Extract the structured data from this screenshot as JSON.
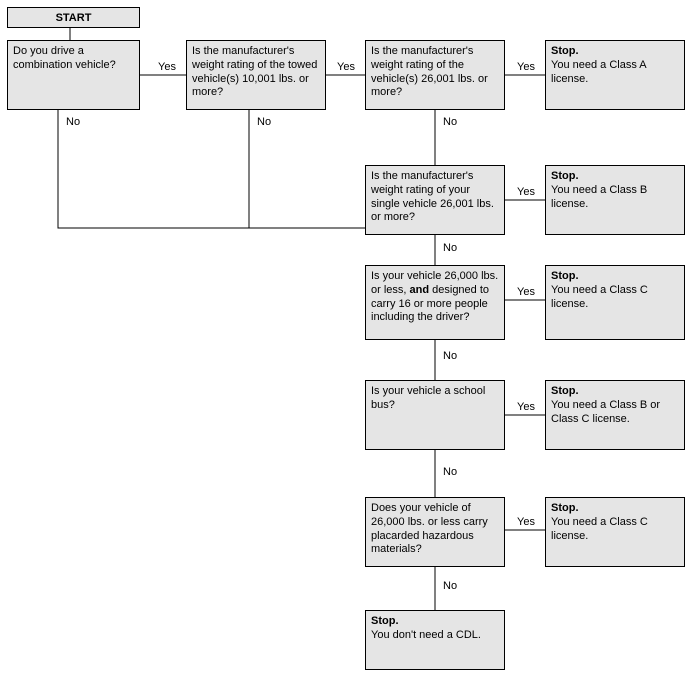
{
  "chart_data": {
    "type": "flowchart",
    "nodes": [
      {
        "id": "start",
        "type": "start",
        "text": "START"
      },
      {
        "id": "q1",
        "type": "decision",
        "text": "Do you drive a combination vehicle?"
      },
      {
        "id": "q2",
        "type": "decision",
        "text": "Is the manufacturer's weight rating of the towed vehicle(s) 10,001 lbs. or more?"
      },
      {
        "id": "q3",
        "type": "decision",
        "text": "Is the manufacturer's weight rating of the vehicle(s) 26,001 lbs. or more?"
      },
      {
        "id": "stopA",
        "type": "stop",
        "text": "You need a Class A license."
      },
      {
        "id": "q4",
        "type": "decision",
        "text": "Is the manufacturer's weight rating of your single vehicle 26,001 lbs. or more?"
      },
      {
        "id": "stopB",
        "type": "stop",
        "text": "You need a Class B license."
      },
      {
        "id": "q5",
        "type": "decision",
        "text_pre": "Is your vehicle 26,000 lbs. or less, ",
        "text_bold": "and",
        "text_post": " designed to carry 16 or more people including the driver?"
      },
      {
        "id": "stopC1",
        "type": "stop",
        "text": "You need a Class C license."
      },
      {
        "id": "q6",
        "type": "decision",
        "text": "Is your vehicle a school bus?"
      },
      {
        "id": "stopBC",
        "type": "stop",
        "text": "You need a Class B or Class C license."
      },
      {
        "id": "q7",
        "type": "decision",
        "text": "Does your vehicle of 26,000 lbs. or less carry placarded hazardous materials?"
      },
      {
        "id": "stopC2",
        "type": "stop",
        "text": "You need a Class C license."
      },
      {
        "id": "stopNone",
        "type": "stop",
        "text": "You don't need a CDL."
      }
    ],
    "edges": [
      {
        "from": "start",
        "to": "q1"
      },
      {
        "from": "q1",
        "to": "q2",
        "label": "Yes"
      },
      {
        "from": "q1",
        "to": "q4",
        "label": "No"
      },
      {
        "from": "q2",
        "to": "q3",
        "label": "Yes"
      },
      {
        "from": "q2",
        "to": "q4",
        "label": "No"
      },
      {
        "from": "q3",
        "to": "stopA",
        "label": "Yes"
      },
      {
        "from": "q3",
        "to": "q4",
        "label": "No"
      },
      {
        "from": "q4",
        "to": "stopB",
        "label": "Yes"
      },
      {
        "from": "q4",
        "to": "q5",
        "label": "No"
      },
      {
        "from": "q5",
        "to": "stopC1",
        "label": "Yes"
      },
      {
        "from": "q5",
        "to": "q6",
        "label": "No"
      },
      {
        "from": "q6",
        "to": "stopBC",
        "label": "Yes"
      },
      {
        "from": "q6",
        "to": "q7",
        "label": "No"
      },
      {
        "from": "q7",
        "to": "stopC2",
        "label": "Yes"
      },
      {
        "from": "q7",
        "to": "stopNone",
        "label": "No"
      }
    ]
  },
  "labels": {
    "yes": "Yes",
    "no": "No",
    "stop": "Stop."
  },
  "text": {
    "start": "START",
    "q1": "Do you drive a combination vehicle?",
    "q2": "Is the manufacturer's weight rating of the towed vehicle(s) 10,001 lbs. or more?",
    "q3": "Is the manufacturer's weight rating of the vehicle(s) 26,001 lbs. or more?",
    "stopA": "You need a Class A license.",
    "q4": "Is the manufacturer's weight rating of your single vehicle 26,001 lbs. or more?",
    "stopB": "You need a Class B license.",
    "q5_pre": "Is your vehicle 26,000 lbs. or less, ",
    "q5_bold": "and",
    "q5_post": " designed to carry 16 or more people including the driver?",
    "stopC1": "You need a Class C license.",
    "q6": "Is your vehicle a school bus?",
    "stopBC": "You need a Class B or Class C license.",
    "q7": "Does your vehicle of 26,000 lbs. or less carry placarded hazardous materials?",
    "stopC2": "You need a Class C license.",
    "stopNone": "You don't need a CDL."
  }
}
